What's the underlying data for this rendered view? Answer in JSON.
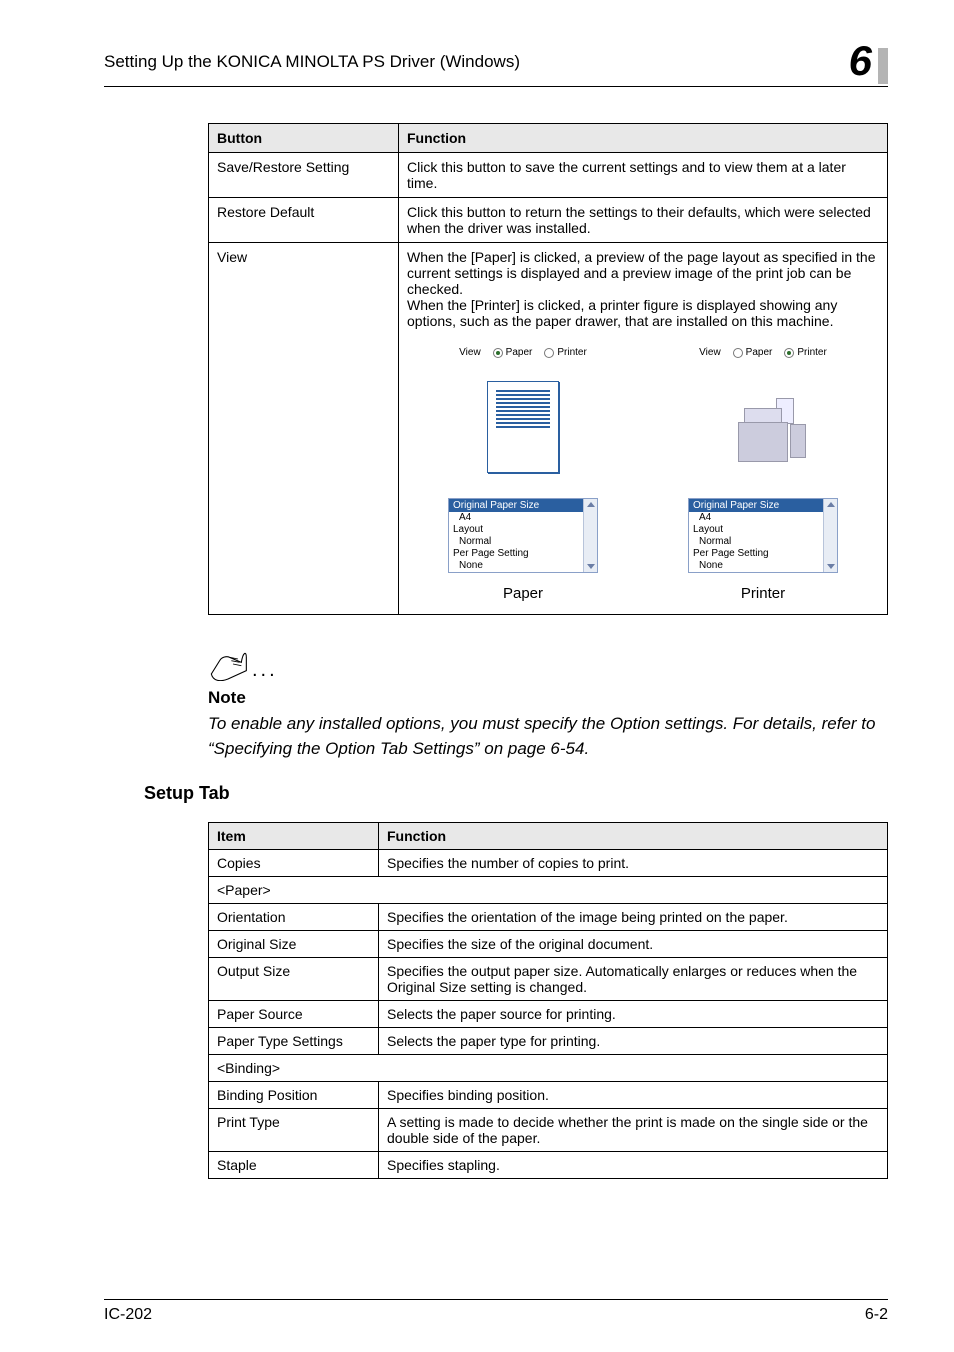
{
  "header": {
    "title": "Setting Up the KONICA MINOLTA PS Driver (Windows)",
    "chapter": "6"
  },
  "table1": {
    "head": {
      "button": "Button",
      "function": "Function"
    },
    "rows": [
      {
        "button": "Save/Restore Setting",
        "function": "Click this button to save the current settings and to view them at a later time."
      },
      {
        "button": "Restore Default",
        "function": "Click this button to return the settings to their defaults, which were selected when the driver was installed."
      },
      {
        "button": "View",
        "function": "When the [Paper] is clicked, a preview of the page layout as specified in the current settings is displayed and a preview image of the print job can be checked.\nWhen the [Printer] is clicked, a printer figure is displayed showing any options, such as the paper drawer, that are installed on this machine."
      }
    ],
    "thumbs": {
      "view_label": "View",
      "paper_radio": "Paper",
      "printer_radio": "Printer",
      "listbox": {
        "hl": "Original Paper Size",
        "r1": "A4",
        "r2": "Layout",
        "r3": "Normal",
        "r4": "Per Page Setting",
        "r5": "None"
      },
      "caption_paper": "Paper",
      "caption_printer": "Printer"
    }
  },
  "note": {
    "heading": "Note",
    "body": "To enable any installed options, you must specify the Option settings. For details, refer to “Specifying the Option Tab Settings” on page 6-54."
  },
  "section2": {
    "heading": "Setup Tab"
  },
  "table2": {
    "head": {
      "item": "Item",
      "function": "Function"
    },
    "rows": [
      {
        "item": "Copies",
        "function": "Specifies the number of copies to print."
      },
      {
        "span": "<Paper>"
      },
      {
        "item": "Orientation",
        "function": "Specifies the orientation of the image being printed on the paper."
      },
      {
        "item": "Original Size",
        "function": "Specifies the size of the original document."
      },
      {
        "item": "Output Size",
        "function": "Specifies the output paper size. Automatically enlarges or reduces when the Original Size setting is changed."
      },
      {
        "item": "Paper Source",
        "function": "Selects the paper source for printing."
      },
      {
        "item": "Paper Type Settings",
        "function": "Selects the paper type for printing."
      },
      {
        "span": "<Binding>"
      },
      {
        "item": "Binding Position",
        "function": "Specifies binding position."
      },
      {
        "item": "Print Type",
        "function": "A setting is made to decide whether the print is made on the single side or the double side of the paper."
      },
      {
        "item": "Staple",
        "function": "Specifies stapling."
      }
    ]
  },
  "footer": {
    "left": "IC-202",
    "right": "6-2"
  }
}
